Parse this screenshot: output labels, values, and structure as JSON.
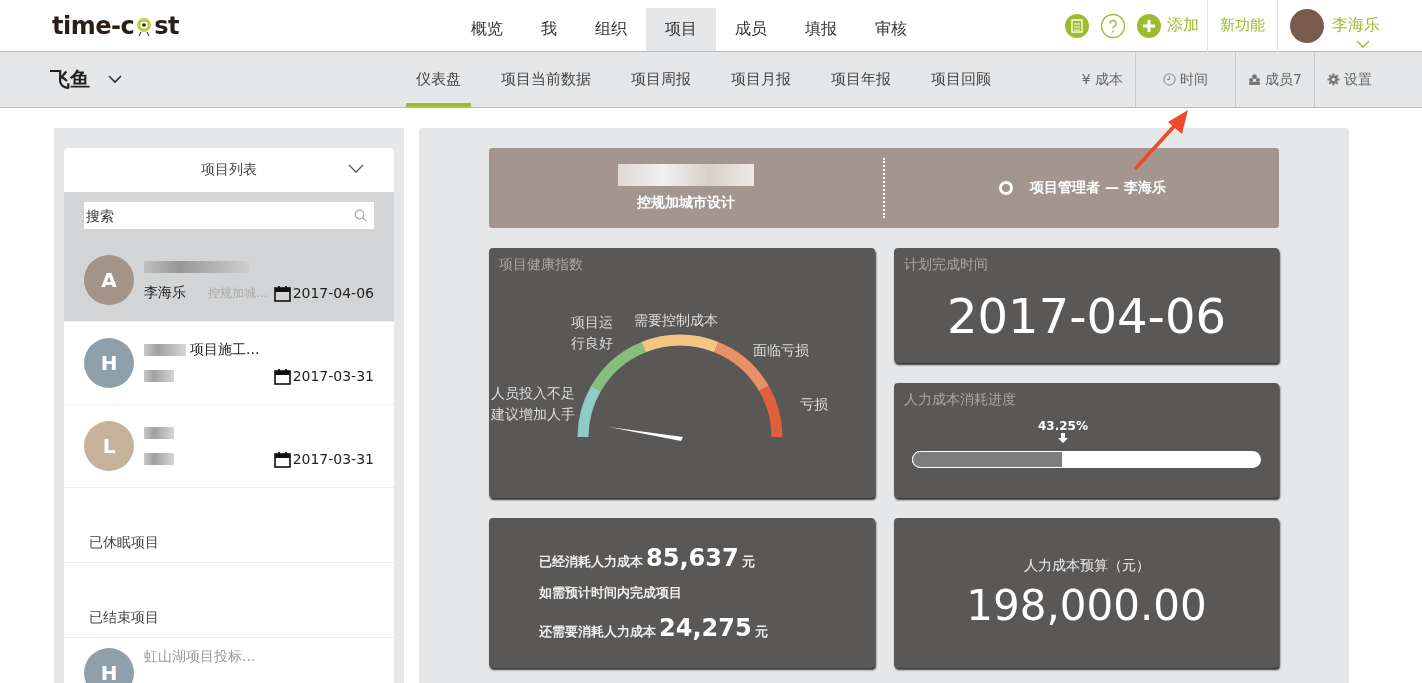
{
  "header": {
    "logo": {
      "left": "time-c",
      "right": "st"
    },
    "nav": [
      {
        "label": "概览",
        "selected": false
      },
      {
        "label": "我",
        "selected": false
      },
      {
        "label": "组织",
        "selected": false
      },
      {
        "label": "项目",
        "selected": true
      },
      {
        "label": "成员",
        "selected": false
      },
      {
        "label": "填报",
        "selected": false
      },
      {
        "label": "审核",
        "selected": false
      }
    ],
    "add_label": "添加",
    "new_features": "新功能",
    "user": "李海乐"
  },
  "subbar": {
    "project": "飞鱼",
    "tabs": [
      {
        "label": "仪表盘",
        "selected": true
      },
      {
        "label": "项目当前数据",
        "selected": false
      },
      {
        "label": "项目周报",
        "selected": false
      },
      {
        "label": "项目月报",
        "selected": false
      },
      {
        "label": "项目年报",
        "selected": false
      },
      {
        "label": "项目回顾",
        "selected": false
      }
    ],
    "tools": [
      {
        "kind": "cost",
        "label": "¥ 成本"
      },
      {
        "kind": "time",
        "label": "时间"
      },
      {
        "kind": "members",
        "label": "成员7"
      },
      {
        "kind": "settings",
        "label": "设置"
      }
    ]
  },
  "sidebar": {
    "title": "项目列表",
    "search": {
      "placeholder": "搜索"
    },
    "projects": [
      {
        "letter": "A",
        "color": "#a39389",
        "owner": "李海乐",
        "subtitle": "控规加城...",
        "date": "2017-04-06",
        "selected": true
      },
      {
        "letter": "H",
        "color": "#8fa0ab",
        "title": "项目施工...",
        "date": "2017-03-31",
        "selected": false
      },
      {
        "letter": "L",
        "color": "#c6b29a",
        "date": "2017-03-31",
        "selected": false
      }
    ],
    "sections": [
      "已休眠项目",
      "已结束项目"
    ],
    "ended": [
      {
        "letter": "H",
        "color": "#8fa0ab",
        "title": "虹山湖项目投标..."
      }
    ]
  },
  "banner": {
    "project_name": "控规加城市设计",
    "manager": "项目管理者 — 李海乐"
  },
  "health": {
    "title": "项目健康指数",
    "zones": [
      "人员投入不足建议增加人手",
      "项目运行良好",
      "需要控制成本",
      "面临亏损",
      "亏损"
    ]
  },
  "deadline": {
    "title": "计划完成时间",
    "date": "2017-04-06"
  },
  "progress": {
    "title": "人力成本消耗进度",
    "reading": "43.25%",
    "level": 0.4325
  },
  "consumption": {
    "spent_label": "已经消耗人力成本",
    "spent": "85,637",
    "unit": "元",
    "note": "如需预计时间内完成项目",
    "remaining_label": "还需要消耗人力成本",
    "remaining": "24,275",
    "remaining_unit": "元"
  },
  "budget": {
    "title": "人力成本预算（元）",
    "amount": "198,000.00"
  }
}
